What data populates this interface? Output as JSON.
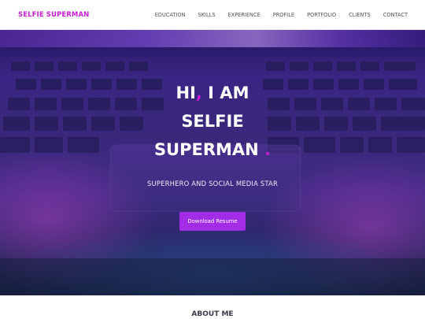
{
  "navbar": {
    "brand": "SELFIE SUPERMAN",
    "links": [
      "EDUCATION",
      "SKILLS",
      "EXPERIENCE",
      "PROFILE",
      "PORTFOLIO",
      "CLIENTS",
      "CONTACT"
    ]
  },
  "hero": {
    "line1_a": "HI",
    "line1_comma": ",",
    "line1_b": " I AM",
    "line2": "SELFIE",
    "line3": "SUPERMAN",
    "line3_dot": ".",
    "subtitle": "SUPERHERO AND SOCIAL MEDIA STAR",
    "button_label": "Download Resume",
    "background_image": "laptop-keyboard-photo"
  },
  "about": {
    "heading": "ABOUT ME"
  },
  "colors": {
    "accent": "#c51fcf",
    "button": "#a32ce6",
    "nav_text": "#555555",
    "hero_base": "#3d2a8c"
  }
}
